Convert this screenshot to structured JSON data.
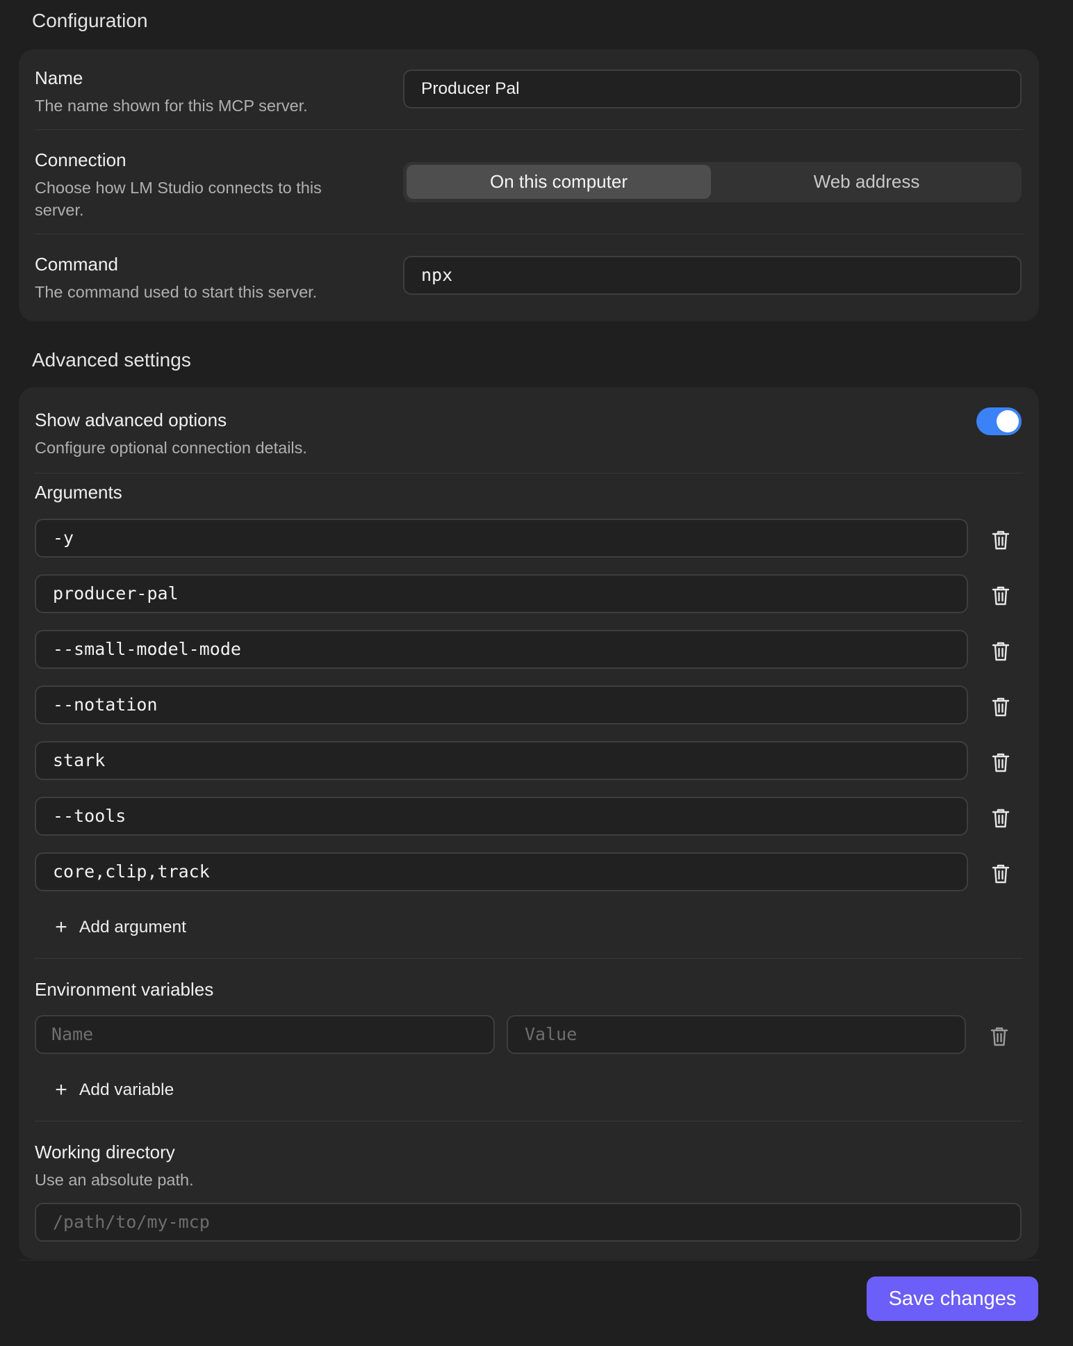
{
  "configuration": {
    "section_title": "Configuration",
    "name": {
      "label": "Name",
      "description": "The name shown for this MCP server.",
      "value": "Producer Pal"
    },
    "connection": {
      "label": "Connection",
      "description": "Choose how LM Studio connects to this server.",
      "options": [
        "On this computer",
        "Web address"
      ],
      "selected": "On this computer"
    },
    "command": {
      "label": "Command",
      "description": "The command used to start this server.",
      "value": "npx"
    }
  },
  "advanced": {
    "section_title": "Advanced settings",
    "show_advanced": {
      "label": "Show advanced options",
      "description": "Configure optional connection details.",
      "enabled": true
    },
    "arguments": {
      "label": "Arguments",
      "items": [
        "-y",
        "producer-pal",
        "--small-model-mode",
        "--notation",
        "stark",
        "--tools",
        "core,clip,track"
      ],
      "add_label": "Add argument"
    },
    "environment_variables": {
      "label": "Environment variables",
      "name_placeholder": "Name",
      "value_placeholder": "Value",
      "add_label": "Add variable"
    },
    "working_directory": {
      "label": "Working directory",
      "description": "Use an absolute path.",
      "placeholder": "/path/to/my-mcp"
    }
  },
  "footer": {
    "save_label": "Save changes"
  },
  "colors": {
    "accent": "#3b82f6",
    "save_button": "#6c5ef8",
    "background": "#1f1f1f",
    "card": "#282828"
  },
  "icons": {
    "delete": "trash-icon",
    "add": "plus-icon"
  }
}
